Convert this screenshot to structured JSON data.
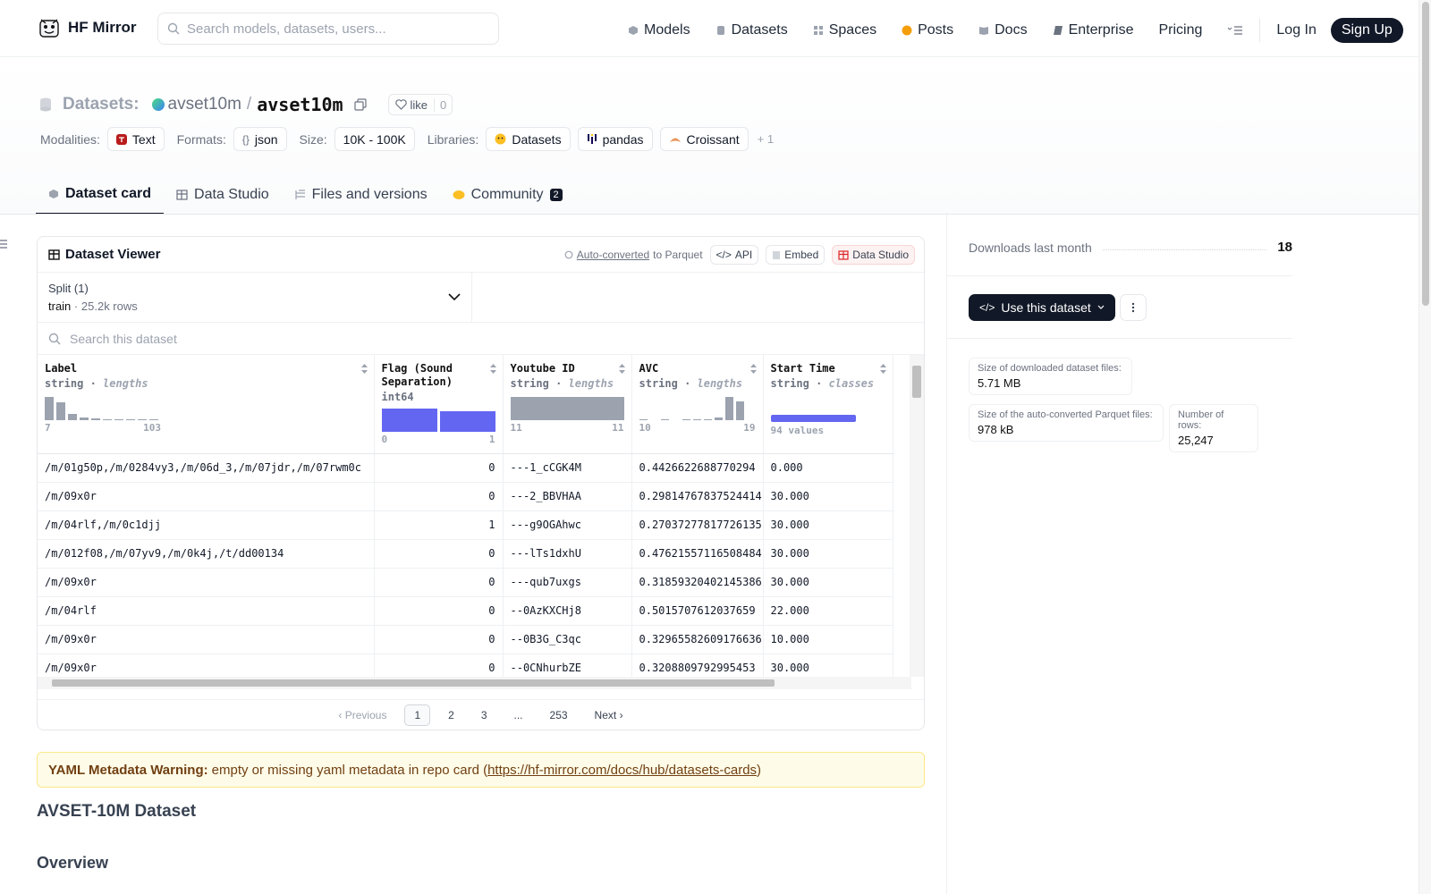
{
  "header": {
    "logo_text": "HF Mirror",
    "search_placeholder": "Search models, datasets, users...",
    "nav": [
      {
        "label": "Models",
        "icon": "cube-icon",
        "color": "#9ca3af"
      },
      {
        "label": "Datasets",
        "icon": "database-icon",
        "color": "#9ca3af"
      },
      {
        "label": "Spaces",
        "icon": "grid-icon",
        "color": "#9ca3af"
      },
      {
        "label": "Posts",
        "icon": "speech-bubble-icon",
        "color": "#f59e0b"
      },
      {
        "label": "Docs",
        "icon": "book-icon",
        "color": "#9ca3af"
      },
      {
        "label": "Enterprise",
        "icon": "building-icon",
        "color": "#6b7280"
      },
      {
        "label": "Pricing",
        "icon": "",
        "color": ""
      }
    ],
    "login": "Log In",
    "signup": "Sign Up"
  },
  "repo": {
    "prefix": "Datasets:",
    "owner": "avset10m",
    "separator": "/",
    "name": "avset10m",
    "like_label": "like",
    "like_count": "0"
  },
  "tags": {
    "modalities_label": "Modalities:",
    "modality": "Text",
    "formats_label": "Formats:",
    "format": "json",
    "size_label": "Size:",
    "size": "10K - 100K",
    "libraries_label": "Libraries:",
    "libraries": [
      "Datasets",
      "pandas",
      "Croissant"
    ],
    "more": "+ 1"
  },
  "tabs": [
    {
      "label": "Dataset card",
      "active": true
    },
    {
      "label": "Data Studio",
      "active": false
    },
    {
      "label": "Files and versions",
      "active": false
    },
    {
      "label": "Community",
      "active": false,
      "badge": "2"
    }
  ],
  "viewer": {
    "title": "Dataset Viewer",
    "auto_converted": "Auto-converted",
    "to_parquet": "to Parquet",
    "api": "API",
    "embed": "Embed",
    "data_studio": "Data Studio",
    "split_label": "Split (1)",
    "split_name": "train",
    "split_dot": "·",
    "split_rows": "25.2k rows",
    "search_placeholder": "Search this dataset",
    "columns": [
      {
        "name": "Label",
        "type": "string",
        "sub": "lengths",
        "min": "7",
        "max": "103"
      },
      {
        "name": "Flag (Sound Separation)",
        "type": "int64",
        "sub": "",
        "min": "0",
        "max": "1"
      },
      {
        "name": "Youtube ID",
        "type": "string",
        "sub": "lengths",
        "min": "11",
        "max": "11"
      },
      {
        "name": "AVC",
        "type": "string",
        "sub": "lengths",
        "min": "10",
        "max": "19"
      },
      {
        "name": "Start Time",
        "type": "string",
        "sub": "classes",
        "min": "94 values",
        "max": ""
      }
    ],
    "rows": [
      [
        "/m/01g50p,/m/0284vy3,/m/06d_3,/m/07jdr,/m/07rwm0c",
        "0",
        "---1_cCGK4M",
        "0.4426622688770294",
        "0.000"
      ],
      [
        "/m/09x0r",
        "0",
        "---2_BBVHAA",
        "0.29814767837524414",
        "30.000"
      ],
      [
        "/m/04rlf,/m/0c1djj",
        "1",
        "---g9OGAhwc",
        "0.27037277817726135",
        "30.000"
      ],
      [
        "/m/012f08,/m/07yv9,/m/0k4j,/t/dd00134",
        "0",
        "---lTs1dxhU",
        "0.47621557116508484",
        "30.000"
      ],
      [
        "/m/09x0r",
        "0",
        "---qub7uxgs",
        "0.31859320402145386",
        "30.000"
      ],
      [
        "/m/04rlf",
        "0",
        "--0AzKXCHj8",
        "0.5015707612037659",
        "22.000"
      ],
      [
        "/m/09x0r",
        "0",
        "--0B3G_C3qc",
        "0.32965582609176636",
        "10.000"
      ],
      [
        "/m/09x0r",
        "0",
        "--0CNhurbZE",
        "0.3208809792995453",
        "30.000"
      ]
    ],
    "pager": {
      "prev": "Previous",
      "pages": [
        "1",
        "2",
        "3",
        "...",
        "253"
      ],
      "next": "Next",
      "current": "1"
    }
  },
  "warning": {
    "bold": "YAML Metadata Warning:",
    "text": "empty or missing yaml metadata in repo card (",
    "link": "https://hf-mirror.com/docs/hub/datasets-cards",
    "close": ")"
  },
  "card": {
    "h2": "AVSET-10M Dataset",
    "h3": "Overview"
  },
  "sidebar": {
    "downloads_label": "Downloads last month",
    "downloads_value": "18",
    "use_button": "Use this dataset",
    "stats": [
      {
        "k": "Size of downloaded dataset files:",
        "v": "5.71 MB"
      },
      {
        "k": "Size of the auto-converted Parquet files:",
        "v": "978 kB"
      },
      {
        "k": "Number of rows:",
        "v": "25,247"
      }
    ]
  },
  "colors": {
    "accent": "#111827",
    "histogram_int": "#6366f1",
    "histogram_gray": "#9ca3af",
    "warning_bg": "#fefce8"
  }
}
